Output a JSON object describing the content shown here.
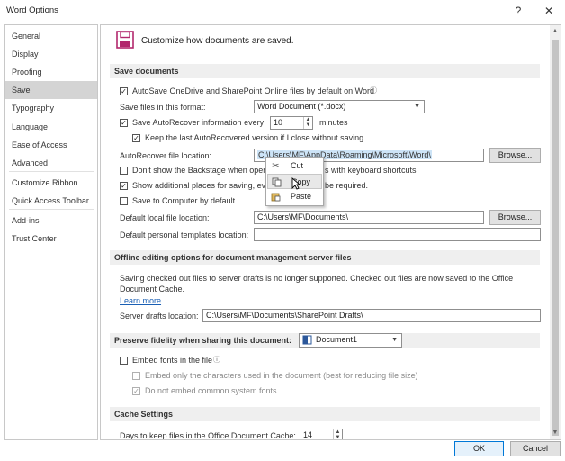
{
  "window": {
    "title": "Word Options",
    "help_glyph": "?",
    "close_glyph": "✕"
  },
  "nav": {
    "items": [
      {
        "label": "General"
      },
      {
        "label": "Display"
      },
      {
        "label": "Proofing"
      },
      {
        "label": "Save"
      },
      {
        "label": "Typography"
      },
      {
        "label": "Language"
      },
      {
        "label": "Ease of Access"
      },
      {
        "label": "Advanced"
      },
      {
        "label": "Customize Ribbon"
      },
      {
        "label": "Quick Access Toolbar"
      },
      {
        "label": "Add-ins"
      },
      {
        "label": "Trust Center"
      }
    ],
    "selected": "Save"
  },
  "header": {
    "text": "Customize how documents are saved."
  },
  "save_documents": {
    "title": "Save documents",
    "autosave_label": "AutoSave OneDrive and SharePoint Online files by default on Word",
    "autosave_checked": true,
    "info_glyph": "ⓘ",
    "format_label": "Save files in this format:",
    "format_value": "Word Document (*.docx)",
    "autorecover_label": "Save AutoRecover information every",
    "autorecover_checked": true,
    "autorecover_minutes": "10",
    "minutes_label": "minutes",
    "keep_last_label": "Keep the last AutoRecovered version if I close without saving",
    "keep_last_checked": true,
    "autorecover_location_label": "AutoRecover file location:",
    "autorecover_location_value": "C:\\Users\\MF\\AppData\\Roaming\\Microsoft\\Word\\",
    "browse_label": "Browse...",
    "backstage_label_a": "Don't show the Backstage when open",
    "backstage_label_b": "s with keyboard shortcuts",
    "backstage_checked": false,
    "additional_places_label_a": "Show additional places for saving, eve",
    "additional_places_label_b": "be required.",
    "additional_places_checked": true,
    "save_to_computer_label": "Save to Computer by default",
    "save_to_computer_checked": false,
    "default_local_label": "Default local file location:",
    "default_local_value": "C:\\Users\\MF\\Documents\\",
    "browse2_label": "Browse...",
    "personal_templates_label": "Default personal templates location:",
    "personal_templates_value": ""
  },
  "context_menu": {
    "items": [
      {
        "label": "Cut",
        "icon": "scissors-icon"
      },
      {
        "label": "Copy",
        "icon": "copy-icon"
      },
      {
        "label": "Paste",
        "icon": "paste-icon"
      }
    ],
    "highlighted": "Copy"
  },
  "offline": {
    "title": "Offline editing options for document management server files",
    "info_line1": "Saving checked out files to server drafts is no longer supported. Checked out files are now saved to the Office",
    "info_line2": "Document Cache.",
    "learn_more": "Learn more",
    "drafts_label": "Server drafts location:",
    "drafts_value": "C:\\Users\\MF\\Documents\\SharePoint Drafts\\"
  },
  "fidelity": {
    "title": "Preserve fidelity when sharing this document:",
    "document_value": "Document1",
    "embed_fonts_label": "Embed fonts in the file",
    "embed_fonts_checked": false,
    "embed_only_label": "Embed only the characters used in the document (best for reducing file size)",
    "embed_only_checked": false,
    "no_common_label": "Do not embed common system fonts",
    "no_common_checked": true
  },
  "cache": {
    "title": "Cache Settings",
    "days_label": "Days to keep files in the Office Document Cache:",
    "days_value": "14"
  },
  "footer": {
    "ok_label": "OK",
    "cancel_label": "Cancel"
  }
}
